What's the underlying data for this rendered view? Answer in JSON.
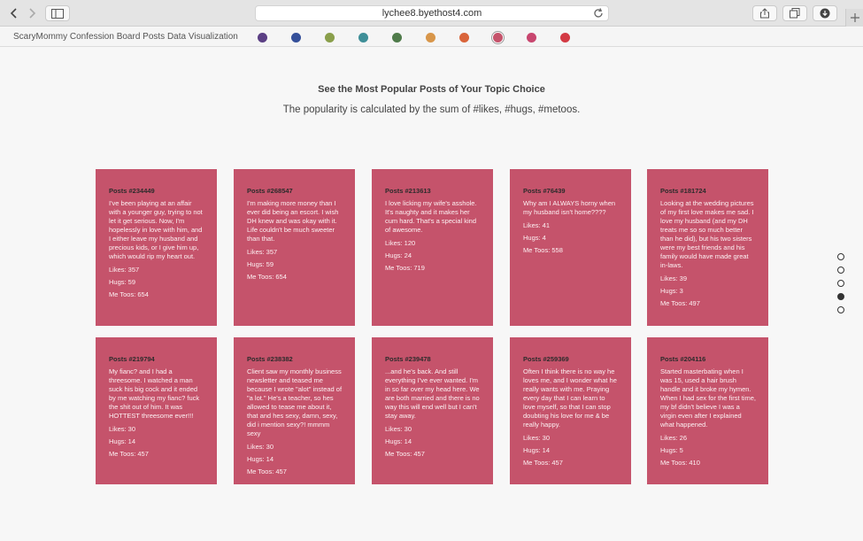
{
  "browser": {
    "url": "lychee8.byethost4.com"
  },
  "app": {
    "title": "ScaryMommy Confession Board Posts Data Visualization",
    "topic_colors": [
      "#5b3f84",
      "#35509a",
      "#8a9f4b",
      "#3f8f98",
      "#4f7b4a",
      "#d8964a",
      "#d9643a",
      "#c5536b",
      "#c8466f",
      "#d33a44"
    ],
    "selected_topic_index": 7
  },
  "page": {
    "heading": "See the Most Popular Posts of Your Topic Choice",
    "subheading": "The popularity is calculated by the sum of #likes, #hugs, #metoos."
  },
  "cards": [
    {
      "title": "Posts #234449",
      "body": "I've been playing at an affair with a younger guy, trying to not let it get serious. Now, I'm hopelessly in love with him, and I either leave my husband and precious kids, or I give him up, which would rip my heart out.",
      "likes": "Likes: 357",
      "hugs": "Hugs: 59",
      "metoos": "Me Toos: 654"
    },
    {
      "title": "Posts #268547",
      "body": "I'm making more money than I ever did being an escort. I wish DH knew and was okay with it. Life couldn't be much sweeter than that.",
      "likes": "Likes: 357",
      "hugs": "Hugs: 59",
      "metoos": "Me Toos: 654"
    },
    {
      "title": "Posts #213613",
      "body": "I love licking my wife's asshole. It's naughty and it makes her cum hard. That's a special kind of awesome.",
      "likes": "Likes: 120",
      "hugs": "Hugs: 24",
      "metoos": "Me Toos: 719"
    },
    {
      "title": "Posts #76439",
      "body": "Why am I ALWAYS horny when my husband isn't home????",
      "likes": "Likes: 41",
      "hugs": "Hugs: 4",
      "metoos": "Me Toos: 558"
    },
    {
      "title": "Posts #181724",
      "body": "Looking at the wedding pictures of my first love makes me sad. I love my husband (and my DH treats me so so much better than he did), but his two sisters were my best friends and his family would have made great in-laws.",
      "likes": "Likes: 39",
      "hugs": "Hugs: 3",
      "metoos": "Me Toos: 497"
    },
    {
      "title": "Posts #219794",
      "body": "My fianc? and I had a threesome. I watched a man suck his big cock and it ended by me watching my fianc? fuck the shit out of him. It was HOTTEST threesome ever!!!",
      "likes": "Likes: 30",
      "hugs": "Hugs: 14",
      "metoos": "Me Toos: 457"
    },
    {
      "title": "Posts #238382",
      "body": "Client saw my monthly business newsletter and teased me because I wrote \"alot\" instead of \"a lot.\" He's a teacher, so hes allowed to tease me about it, that and hes sexy, damn, sexy, did i mention sexy?! mmmm sexy",
      "likes": "Likes: 30",
      "hugs": "Hugs: 14",
      "metoos": "Me Toos: 457"
    },
    {
      "title": "Posts #239478",
      "body": "...and he's back. And still everything I've ever wanted. I'm in so far over my head here. We are both married and there is no way this will end well but I can't stay away.",
      "likes": "Likes: 30",
      "hugs": "Hugs: 14",
      "metoos": "Me Toos: 457"
    },
    {
      "title": "Posts #259369",
      "body": "Often I think there is no way he loves me, and I wonder what he really wants with me. Praying every day that I can learn to love myself, so that I can stop doubting his love for me & be really happy.",
      "likes": "Likes: 30",
      "hugs": "Hugs: 14",
      "metoos": "Me Toos: 457"
    },
    {
      "title": "Posts #204116",
      "body": "Started masterbating when I was 15, used a hair brush handle and it broke my hymen. When I had sex for the first time, my bf didn't believe I was a virgin even after I explained what happened.",
      "likes": "Likes: 26",
      "hugs": "Hugs: 5",
      "metoos": "Me Toos: 410"
    }
  ],
  "section_nav": {
    "count": 5,
    "active_index": 3
  }
}
